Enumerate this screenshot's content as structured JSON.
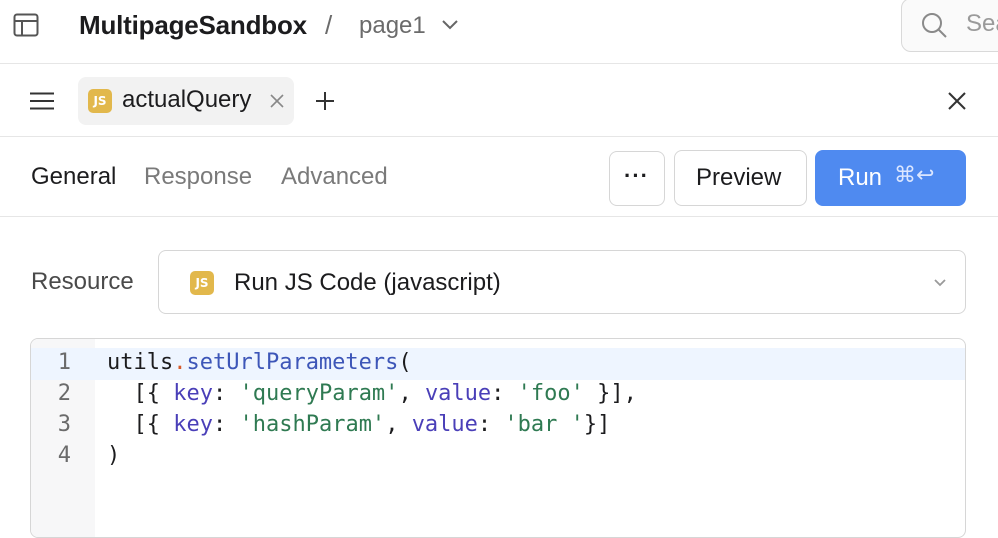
{
  "header": {
    "app_name": "MultipageSandbox",
    "separator": "/",
    "page_name": "page1",
    "search_placeholder": "Search"
  },
  "tabs": {
    "badge": "JS",
    "query_name": "actualQuery"
  },
  "toolbar": {
    "sub_tabs": [
      "General",
      "Response",
      "Advanced"
    ],
    "active_tab": "General",
    "more_label": "···",
    "preview_label": "Preview",
    "run_label": "Run",
    "run_shortcut": "⌘↩"
  },
  "resource": {
    "label": "Resource",
    "badge": "JS",
    "value": "Run JS Code (javascript)"
  },
  "editor": {
    "line_numbers": [
      "1",
      "2",
      "3",
      "4"
    ],
    "tokens": {
      "l1": [
        "utils",
        ".",
        "setUrlParameters",
        "("
      ],
      "l2": [
        "  [{ ",
        "key",
        ": ",
        "'queryParam'",
        ", ",
        "value",
        ": ",
        "'foo'",
        " }],"
      ],
      "l3": [
        "  [{ ",
        "key",
        ": ",
        "'hashParam'",
        ", ",
        "value",
        ": ",
        "'bar '",
        "}]"
      ],
      "l4": [
        ")"
      ]
    }
  },
  "colors": {
    "run_button": "#4f8af0",
    "js_badge": "#e2b84c",
    "active_line": "#eef5ff"
  }
}
